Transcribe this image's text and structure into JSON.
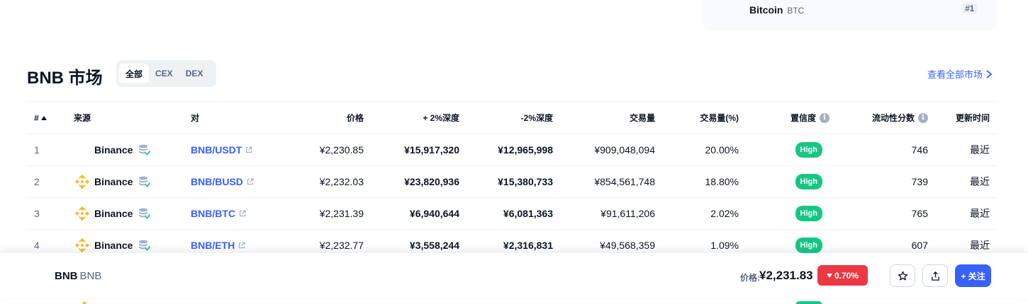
{
  "top_card": {
    "name": "Bitcoin",
    "symbol": "BTC",
    "rank": "#1"
  },
  "markets": {
    "title": "BNB 市场",
    "filters": [
      {
        "label": "全部",
        "active": true
      },
      {
        "label": "CEX",
        "active": false
      },
      {
        "label": "DEX",
        "active": false
      }
    ],
    "view_all": "查看全部市场"
  },
  "table": {
    "headers": {
      "num": "#",
      "source": "来源",
      "pair": "对",
      "price": "价格",
      "depth_plus": "+ 2%深度",
      "depth_minus": "-2%深度",
      "volume": "交易量",
      "volume_pct": "交易量(%)",
      "confidence": "置信度",
      "liquidity": "流动性分数",
      "updated": "更新时间"
    },
    "rows": [
      {
        "num": "1",
        "source": "Binance",
        "pair": "BNB/USDT",
        "price": "¥2,230.85",
        "depth_plus": "¥15,917,320",
        "depth_minus": "¥12,965,998",
        "volume": "¥909,048,094",
        "volume_pct": "20.00%",
        "confidence": "High",
        "liquidity": "746",
        "updated": "最近"
      },
      {
        "num": "2",
        "source": "Binance",
        "pair": "BNB/BUSD",
        "price": "¥2,232.03",
        "depth_plus": "¥23,820,936",
        "depth_minus": "¥15,380,733",
        "volume": "¥854,561,748",
        "volume_pct": "18.80%",
        "confidence": "High",
        "liquidity": "739",
        "updated": "最近"
      },
      {
        "num": "3",
        "source": "Binance",
        "pair": "BNB/BTC",
        "price": "¥2,231.39",
        "depth_plus": "¥6,940,644",
        "depth_minus": "¥6,081,363",
        "volume": "¥91,611,206",
        "volume_pct": "2.02%",
        "confidence": "High",
        "liquidity": "765",
        "updated": "最近"
      },
      {
        "num": "4",
        "source": "Binance",
        "pair": "BNB/ETH",
        "price": "¥2,232.77",
        "depth_plus": "¥3,558,244",
        "depth_minus": "¥2,316,831",
        "volume": "¥49,568,359",
        "volume_pct": "1.09%",
        "confidence": "High",
        "liquidity": "607",
        "updated": "最近"
      }
    ]
  },
  "bottom_bar": {
    "name": "BNB",
    "symbol": "BNB",
    "price_label": "价格:",
    "price": "¥2,231.83",
    "change": "0.70%",
    "follow_label": "+ 关注"
  },
  "colors": {
    "accent": "#3861fb",
    "positive": "#16c784",
    "negative": "#ea3943",
    "bnb": "#f3ba2f"
  },
  "icons": [
    "bnb-logo-icon",
    "verified-stack-icon",
    "external-link-icon",
    "info-icon",
    "star-icon",
    "share-icon",
    "chevron-right-icon",
    "caret-up-icon",
    "caret-down-icon"
  ]
}
